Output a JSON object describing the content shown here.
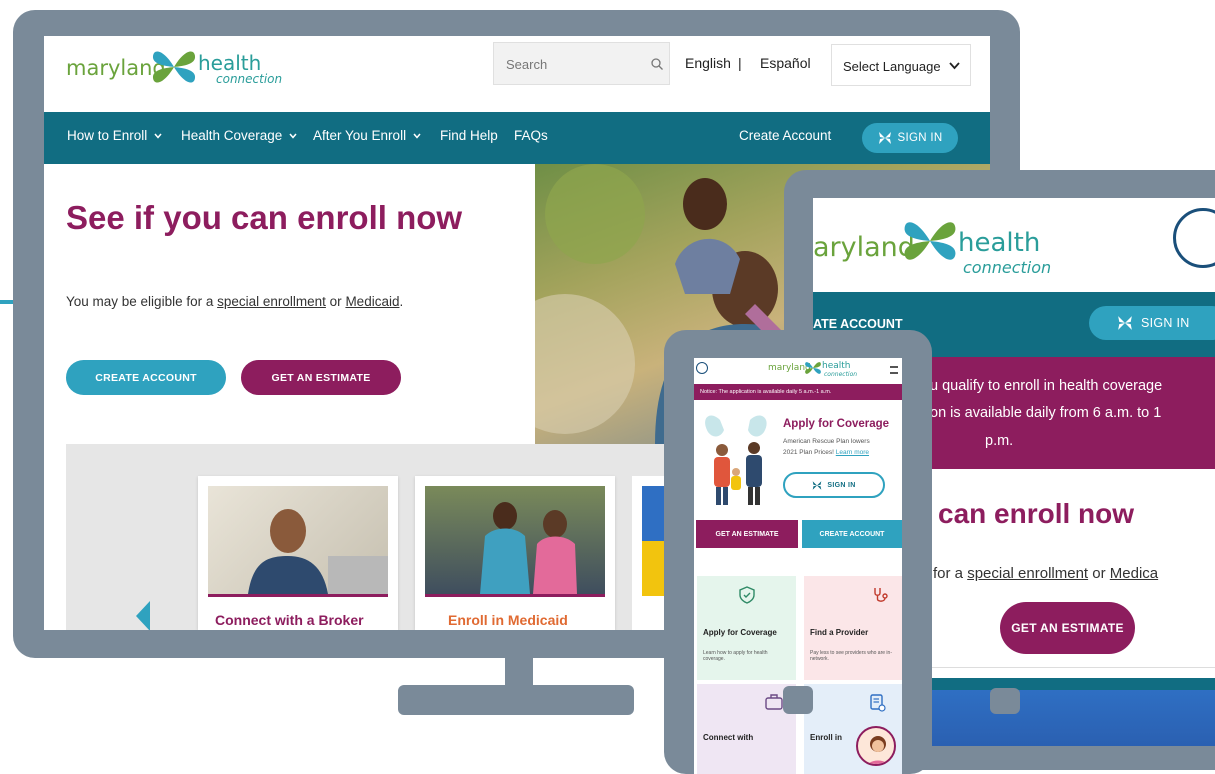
{
  "colors": {
    "nav_teal": "#116d82",
    "purple": "#8d1d5e",
    "button_teal": "#2fa2bf",
    "frame_gray": "#7a8a99",
    "light_gray": "#e6e6e6"
  },
  "desktop": {
    "logo": {
      "word1": "maryland",
      "word2": "health",
      "word3": "connection",
      "tm": "™"
    },
    "search": {
      "placeholder": "Search"
    },
    "lang_links": {
      "english": "English",
      "separator": "|",
      "espanol": "Español"
    },
    "select_language": "Select Language",
    "nav": {
      "items": [
        {
          "label": "How to Enroll",
          "dropdown": true
        },
        {
          "label": "Health Coverage",
          "dropdown": true
        },
        {
          "label": "After You Enroll",
          "dropdown": true
        },
        {
          "label": "Find Help",
          "dropdown": false
        },
        {
          "label": "FAQs",
          "dropdown": false
        }
      ],
      "create_account": "Create Account",
      "sign_in": "SIGN IN"
    },
    "hero": {
      "title": "See if you can enroll now",
      "text_before": "You may be eligible for a ",
      "link1": "special enrollment",
      "text_mid": " or ",
      "link2": "Medicaid",
      "text_after": ".",
      "btn_create": "CREATE ACCOUNT",
      "btn_estimate": "GET AN ESTIMATE"
    },
    "cards": [
      {
        "title": "Connect with a Broker"
      },
      {
        "title": "Enroll in Medicaid"
      }
    ]
  },
  "tablet": {
    "logo": {
      "word1": "aryland",
      "word2": "health",
      "word3": "connection",
      "tm": "™"
    },
    "nav": {
      "create_account": "ATE ACCOUNT",
      "sign_in": "SIGN IN"
    },
    "notice": {
      "line1": "u qualify to enroll in health coverage",
      "line2": "on is available daily from 6 a.m. to 1",
      "line3": "p.m."
    },
    "hero": {
      "title": "can enroll now",
      "text_before": "for a ",
      "link1": "special enrollment",
      "text_mid": " or ",
      "link2": "Medica",
      "btn_estimate": "GET AN ESTIMATE"
    }
  },
  "phone": {
    "logo": {
      "word1": "maryland",
      "word2": "health",
      "word3": "connection"
    },
    "notice": "Notice: The application is available daily 5 a.m.-1 a.m.",
    "hero": {
      "title": "Apply for Coverage",
      "sub1": "American Rescue Plan lowers",
      "sub2": "2021 Plan Prices!",
      "link": "Learn more",
      "sign_in": "SIGN IN"
    },
    "btn_estimate": "GET AN ESTIMATE",
    "btn_create": "CREATE ACCOUNT",
    "tiles": [
      {
        "title": "Apply for Coverage",
        "desc": "Learn how to apply for health coverage."
      },
      {
        "title": "Find a Provider",
        "desc": "Pay less to see providers who are in-network."
      },
      {
        "title": "Connect with",
        "desc": ""
      },
      {
        "title": "Enroll in",
        "desc": ""
      }
    ]
  }
}
